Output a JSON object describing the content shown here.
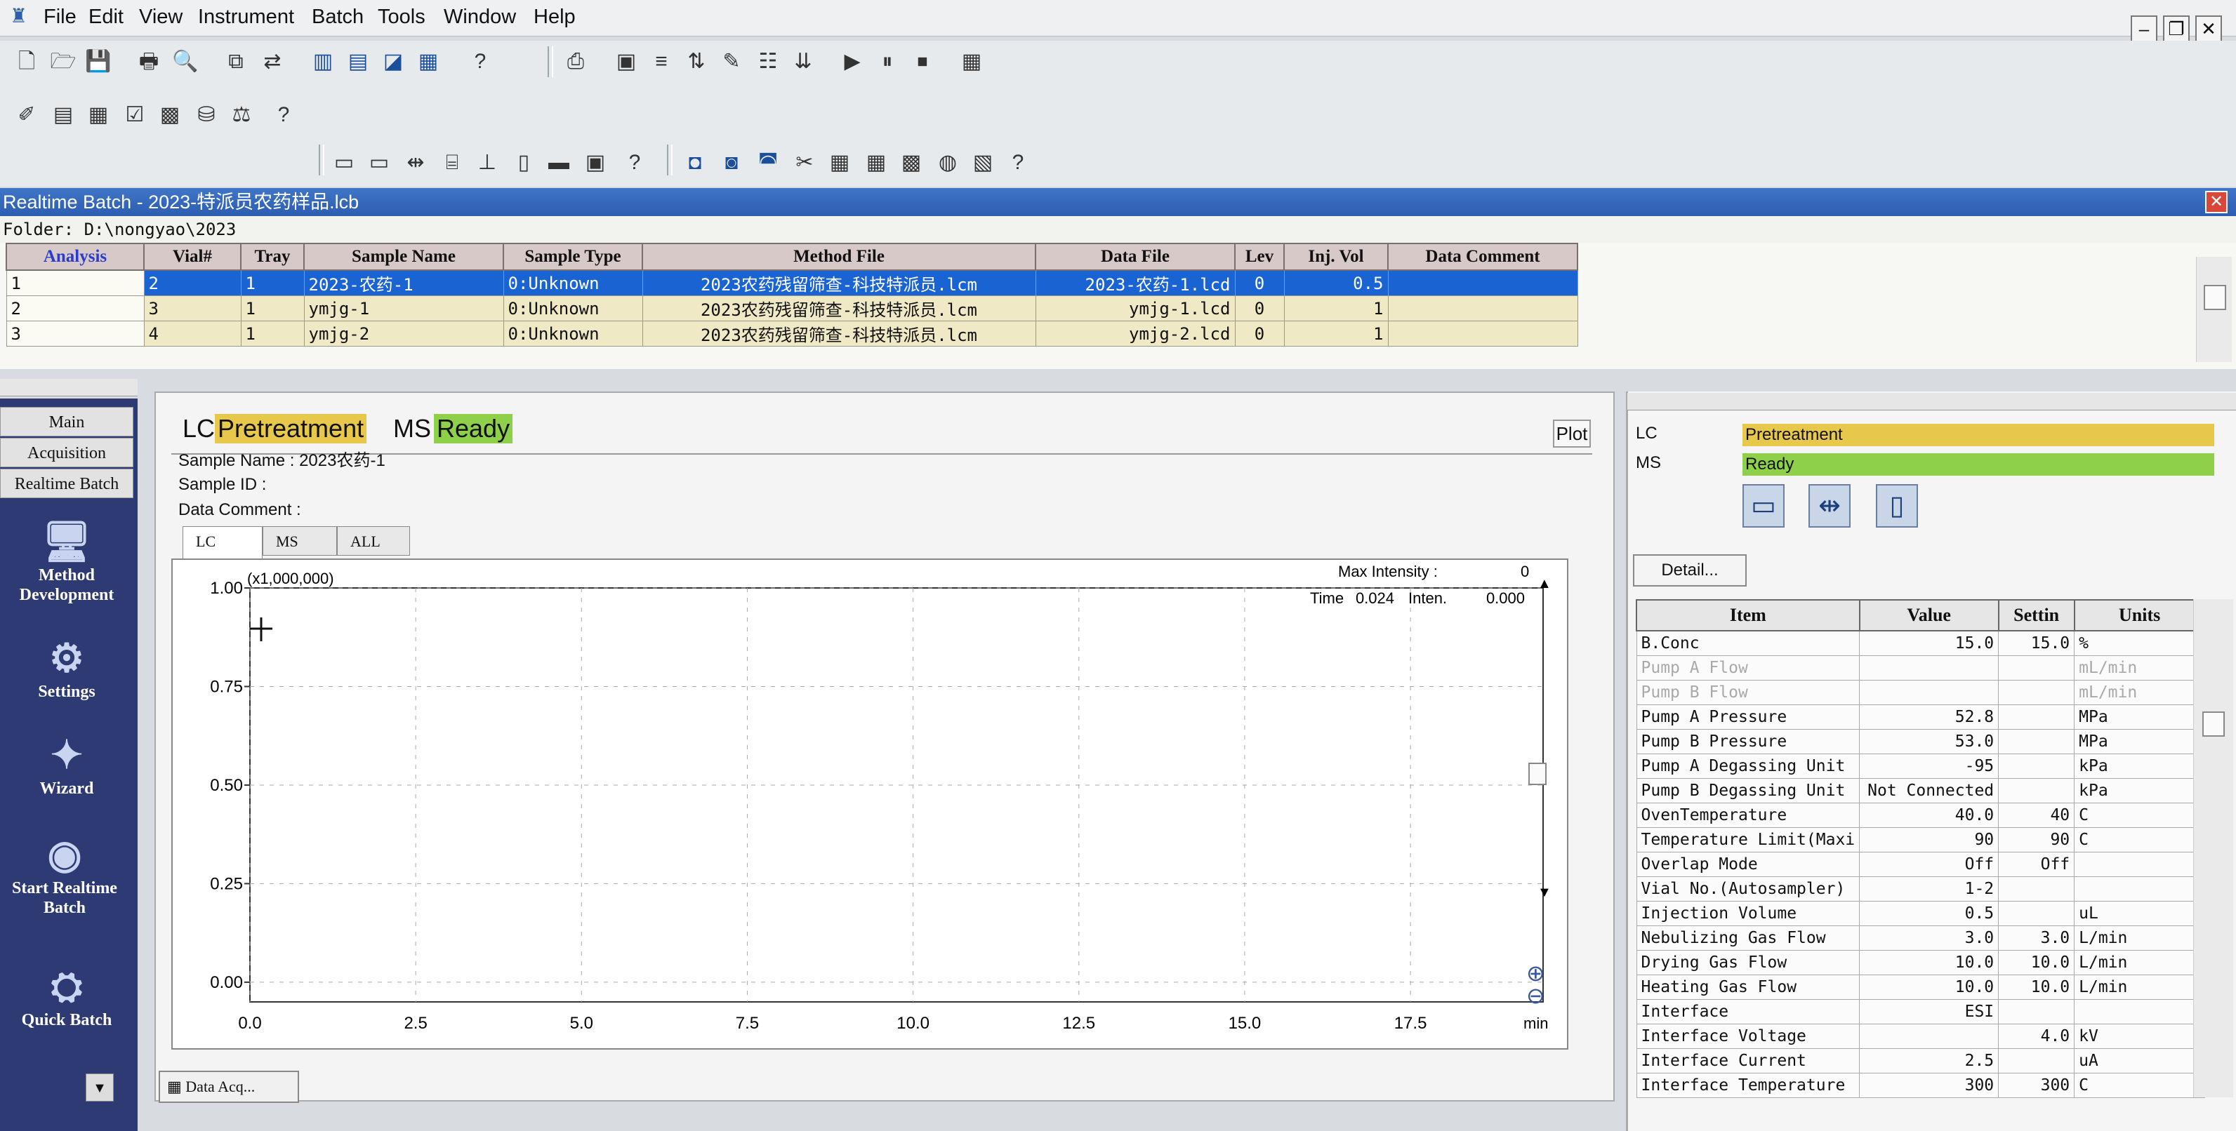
{
  "menu": {
    "items": [
      "File",
      "Edit",
      "View",
      "Instrument",
      "Batch",
      "Tools",
      "Window",
      "Help"
    ],
    "help_glyph": "?"
  },
  "batch_window": {
    "title": "Realtime Batch - 2023-特派员农药样品.lcb",
    "folder": "Folder: D:\\nongyao\\2023",
    "columns": [
      "Analysis",
      "Vial#",
      "Tray",
      "Sample Name",
      "Sample Type",
      "Method File",
      "Data File",
      "Lev",
      "Inj. Vol",
      "Data Comment"
    ],
    "rows": [
      {
        "n": "1",
        "vial": "2",
        "tray": "1",
        "name": "2023-农药-1",
        "type": "0:Unknown",
        "method": "2023农药残留筛查-科技特派员.lcm",
        "data": "2023-农药-1.lcd",
        "lev": "0",
        "vol": "0.5",
        "comment": ""
      },
      {
        "n": "2",
        "vial": "3",
        "tray": "1",
        "name": "ymjg-1",
        "type": "0:Unknown",
        "method": "2023农药残留筛查-科技特派员.lcm",
        "data": "ymjg-1.lcd",
        "lev": "0",
        "vol": "1",
        "comment": ""
      },
      {
        "n": "3",
        "vial": "4",
        "tray": "1",
        "name": "ymjg-2",
        "type": "0:Unknown",
        "method": "2023农药残留筛查-科技特派员.lcm",
        "data": "ymjg-2.lcd",
        "lev": "0",
        "vol": "1",
        "comment": ""
      }
    ]
  },
  "sidebar": {
    "tabs": [
      "Main",
      "Acquisition",
      "Realtime Batch"
    ],
    "nav": [
      {
        "label": "Method Development",
        "icon": "monitor-icon"
      },
      {
        "label": "Settings",
        "icon": "settings-icon"
      },
      {
        "label": "Wizard",
        "icon": "wizard-icon"
      },
      {
        "label": "Start Realtime Batch",
        "icon": "play-icon"
      },
      {
        "label": "Quick Batch",
        "icon": "quick-batch-icon"
      }
    ]
  },
  "status": {
    "lc_label": "LC",
    "lc_value": "Pretreatment",
    "ms_label": "MS",
    "ms_value": "Ready",
    "lc_color": "#e8c84a",
    "ms_color": "#8fd04a"
  },
  "sample": {
    "name_line": "Sample Name : 2023农药-1",
    "id_line": "Sample ID :",
    "comment_line": "Data Comment :"
  },
  "plot_button": "Plot",
  "plot_tabs": [
    "LC",
    "MS",
    "ALL"
  ],
  "chart_data": {
    "type": "line",
    "y_multiplier": "(x1,000,000)",
    "xlabel": "min",
    "xlim": [
      0,
      19.5
    ],
    "ylim": [
      -0.05,
      1.0
    ],
    "x_ticks": [
      "0.0",
      "2.5",
      "5.0",
      "7.5",
      "10.0",
      "12.5",
      "15.0",
      "17.5"
    ],
    "y_ticks": [
      "1.00",
      "0.75",
      "0.50",
      "0.25",
      "0.00"
    ],
    "grid": true,
    "max_intensity_label": "Max Intensity :",
    "max_intensity_value": "0",
    "time_label": "Time",
    "time_value": "0.024",
    "inten_label": "Inten.",
    "inten_value": "0.000",
    "series": []
  },
  "bottom_tab": "Data Acq...",
  "right_panel": {
    "lc_label": "LC",
    "lc_value": "Pretreatment",
    "ms_label": "MS",
    "ms_value": "Ready",
    "detail_button": "Detail...",
    "columns": [
      "Item",
      "Value",
      "Settin",
      "Units"
    ],
    "rows": [
      {
        "item": "B.Conc",
        "value": "15.0",
        "setting": "15.0",
        "units": "%",
        "disabled": false
      },
      {
        "item": "Pump A Flow",
        "value": "",
        "setting": "",
        "units": "mL/min",
        "disabled": true
      },
      {
        "item": "Pump B Flow",
        "value": "",
        "setting": "",
        "units": "mL/min",
        "disabled": true
      },
      {
        "item": "Pump A Pressure",
        "value": "52.8",
        "setting": "",
        "units": "MPa",
        "disabled": false
      },
      {
        "item": "Pump B Pressure",
        "value": "53.0",
        "setting": "",
        "units": "MPa",
        "disabled": false
      },
      {
        "item": "Pump A Degassing Unit",
        "value": "-95",
        "setting": "",
        "units": "kPa",
        "disabled": false
      },
      {
        "item": "Pump B Degassing Unit",
        "value": "Not Connected",
        "setting": "",
        "units": "kPa",
        "disabled": false
      },
      {
        "item": "OvenTemperature",
        "value": "40.0",
        "setting": "40",
        "units": "C",
        "disabled": false
      },
      {
        "item": "Temperature Limit(Maxi",
        "value": "90",
        "setting": "90",
        "units": "C",
        "disabled": false
      },
      {
        "item": "Overlap Mode",
        "value": "Off",
        "setting": "Off",
        "units": "",
        "disabled": false
      },
      {
        "item": "Vial No.(Autosampler)",
        "value": "1-2",
        "setting": "",
        "units": "",
        "disabled": false
      },
      {
        "item": "Injection Volume",
        "value": "0.5",
        "setting": "",
        "units": "uL",
        "disabled": false
      },
      {
        "item": "Nebulizing Gas Flow",
        "value": "3.0",
        "setting": "3.0",
        "units": "L/min",
        "disabled": false
      },
      {
        "item": "Drying Gas Flow",
        "value": "10.0",
        "setting": "10.0",
        "units": "L/min",
        "disabled": false
      },
      {
        "item": "Heating Gas Flow",
        "value": "10.0",
        "setting": "10.0",
        "units": "L/min",
        "disabled": false
      },
      {
        "item": "Interface",
        "value": "ESI",
        "setting": "",
        "units": "",
        "disabled": false
      },
      {
        "item": "Interface Voltage",
        "value": "",
        "setting": "4.0",
        "units": "kV",
        "disabled": false
      },
      {
        "item": "Interface Current",
        "value": "2.5",
        "setting": "",
        "units": "uA",
        "disabled": false
      },
      {
        "item": "Interface Temperature",
        "value": "300",
        "setting": "300",
        "units": "C",
        "disabled": false
      }
    ]
  }
}
